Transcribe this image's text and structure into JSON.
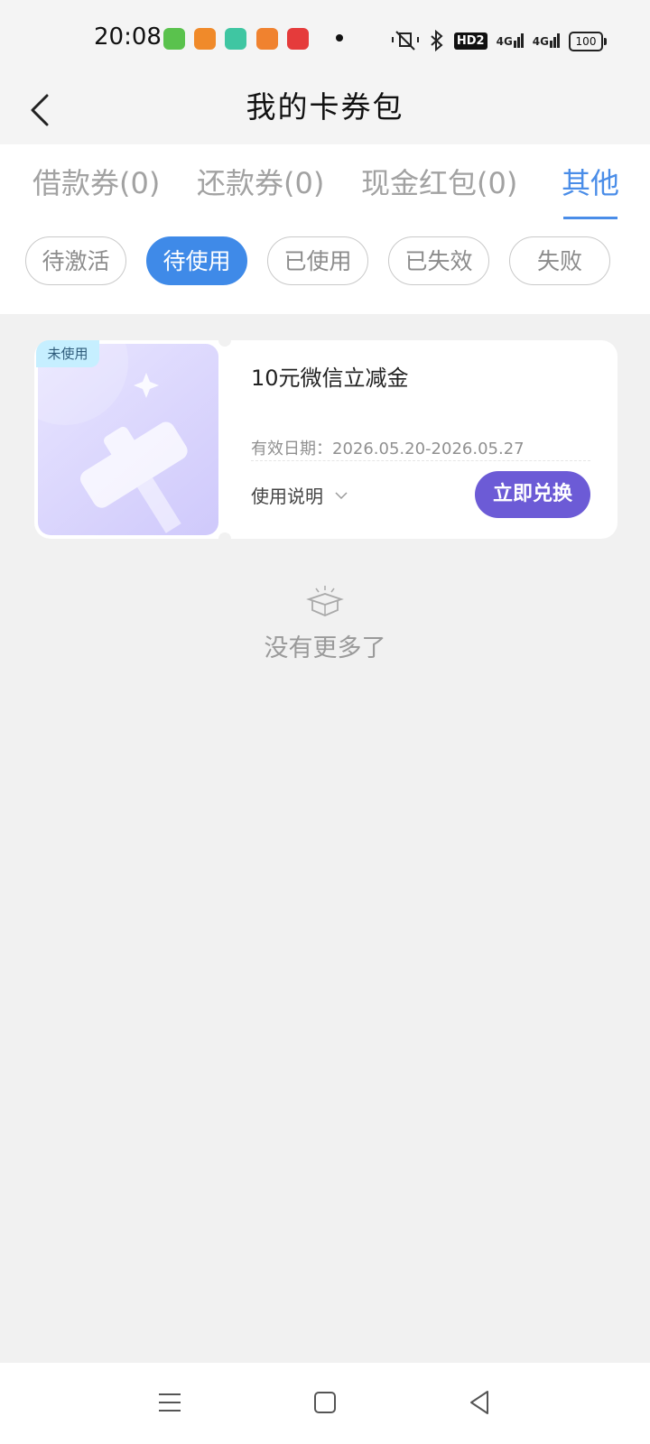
{
  "status_bar": {
    "time": "20:08",
    "battery": "100",
    "network": [
      "4G",
      "4G"
    ],
    "hd": "HD2",
    "app_icons": [
      {
        "name": "app-icon-green",
        "color": "#5ac24d"
      },
      {
        "name": "app-icon-orange-video",
        "color": "#f08a2a"
      },
      {
        "name": "app-icon-download",
        "color": "#3fc6a2"
      },
      {
        "name": "app-icon-orange-2",
        "color": "#f0822f"
      },
      {
        "name": "app-icon-music",
        "color": "#e53b3b"
      }
    ]
  },
  "header": {
    "title": "我的卡券包"
  },
  "tabs": [
    {
      "label": "借款券(0)",
      "active": false
    },
    {
      "label": "还款券(0)",
      "active": false
    },
    {
      "label": "现金红包(0)",
      "active": false
    },
    {
      "label": "其他",
      "active": true
    }
  ],
  "filters": [
    {
      "label": "待激活",
      "active": false
    },
    {
      "label": "待使用",
      "active": true
    },
    {
      "label": "已使用",
      "active": false
    },
    {
      "label": "已失效",
      "active": false
    },
    {
      "label": "失败",
      "active": false
    }
  ],
  "coupon": {
    "badge": "未使用",
    "name": "10元微信立减金",
    "validity": "有效日期：2026.05.20-2026.05.27",
    "usage_label": "使用说明",
    "redeem_label": "立即兑换"
  },
  "empty_state": {
    "text": "没有更多了"
  },
  "colors": {
    "accent_blue": "#3f8ae8",
    "redeem_purple": "#6c5bd6",
    "background": "#f1f1f1"
  }
}
